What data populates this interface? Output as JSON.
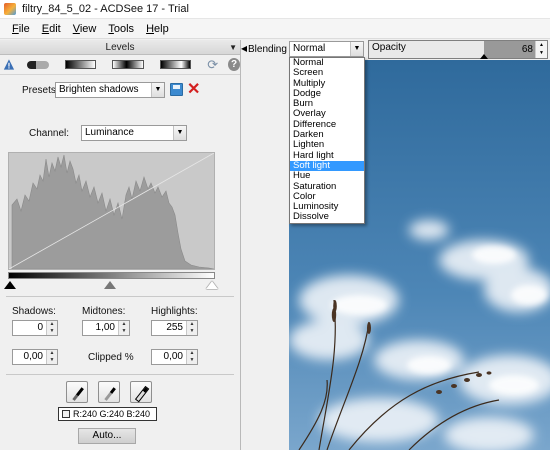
{
  "window": {
    "title": "filtry_84_5_02 - ACDSee 17 - Trial"
  },
  "menu": [
    {
      "accel": "F",
      "rest": "ile"
    },
    {
      "accel": "E",
      "rest": "dit"
    },
    {
      "accel": "V",
      "rest": "iew"
    },
    {
      "accel": "T",
      "rest": "ools"
    },
    {
      "accel": "H",
      "rest": "elp"
    }
  ],
  "panel": {
    "title": "Levels",
    "presets_label": "Presets",
    "preset_value": "Brighten shadows",
    "channel_label": "Channel:",
    "channel_value": "Luminance",
    "shadows_label": "Shadows:",
    "midtones_label": "Midtones:",
    "highlights_label": "Highlights:",
    "shadows_value": "0",
    "midtones_value": "1,00",
    "highlights_value": "255",
    "clip_low_value": "0,00",
    "clip_high_value": "0,00",
    "clipped_label": "Clipped %",
    "rgb_readout": "R:240  G:240  B:240",
    "auto_label": "Auto..."
  },
  "toolbar": {
    "blending_label": "Blending",
    "blending_value": "Normal",
    "opacity_label": "Opacity",
    "opacity_value": "68",
    "opacity_percent": 68
  },
  "blend_modes": [
    "Normal",
    "Screen",
    "Multiply",
    "Dodge",
    "Burn",
    "Overlay",
    "Difference",
    "Darken",
    "Lighten",
    "Hard light",
    "Soft light",
    "Hue",
    "Saturation",
    "Color",
    "Luminosity",
    "Dissolve"
  ],
  "selected_blend_mode": "Soft light",
  "colors": {
    "selection": "#3399ff",
    "sky": "#3a72a0",
    "delete": "#d32020"
  }
}
